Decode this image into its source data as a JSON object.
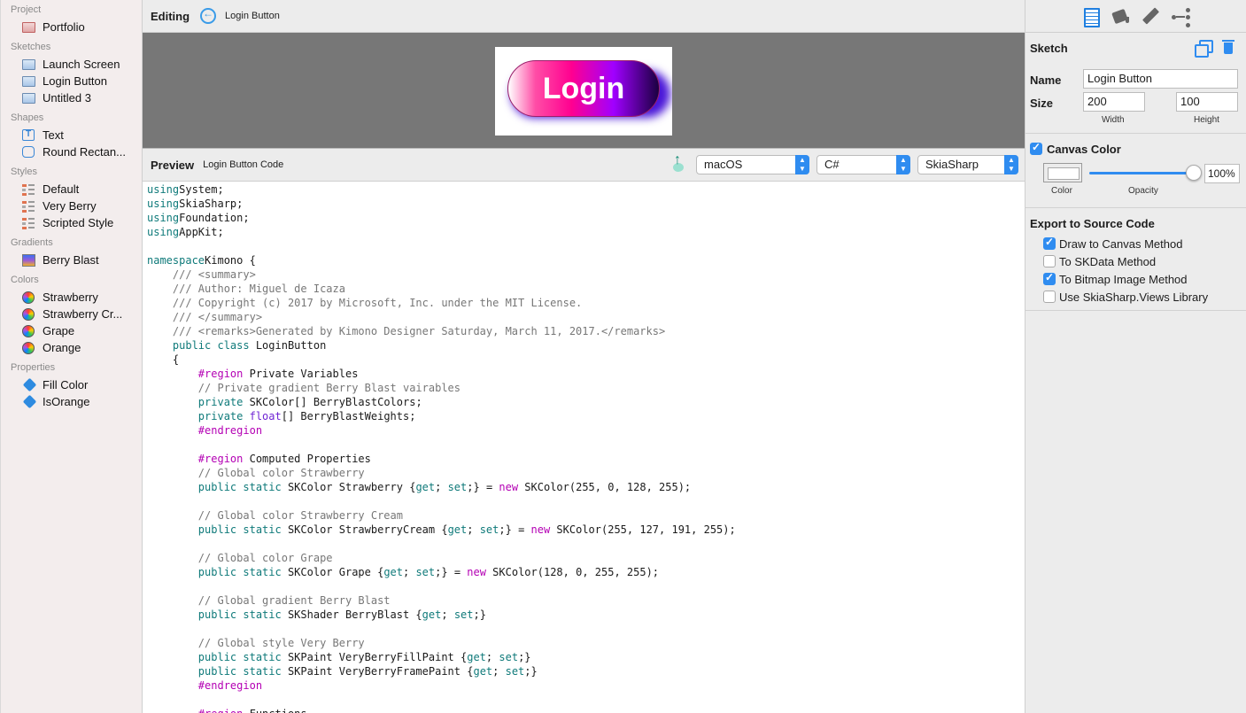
{
  "sidebar": {
    "sections": [
      {
        "title": "Project",
        "items": [
          {
            "label": "Portfolio",
            "icon": "sketch-icon"
          }
        ]
      },
      {
        "title": "Sketches",
        "items": [
          {
            "label": "Launch Screen"
          },
          {
            "label": "Login Button"
          },
          {
            "label": "Untitled 3"
          }
        ]
      },
      {
        "title": "Shapes",
        "items": [
          {
            "label": "Text"
          },
          {
            "label": "Round Rectan..."
          }
        ]
      },
      {
        "title": "Styles",
        "items": [
          {
            "label": "Default"
          },
          {
            "label": "Very Berry"
          },
          {
            "label": "Scripted Style"
          }
        ]
      },
      {
        "title": "Gradients",
        "items": [
          {
            "label": "Berry Blast"
          }
        ]
      },
      {
        "title": "Colors",
        "items": [
          {
            "label": "Strawberry"
          },
          {
            "label": "Strawberry Cr..."
          },
          {
            "label": "Grape"
          },
          {
            "label": "Orange"
          }
        ]
      },
      {
        "title": "Properties",
        "items": [
          {
            "label": "Fill Color"
          },
          {
            "label": "IsOrange"
          }
        ]
      }
    ]
  },
  "editing": {
    "title": "Editing",
    "subtitle": "Login Button",
    "canvas_button_text": "Login"
  },
  "preview": {
    "title": "Preview",
    "subtitle": "Login Button Code",
    "platform": "macOS",
    "language": "C#",
    "library": "SkiaSharp"
  },
  "inspector": {
    "header": "Sketch",
    "name_label": "Name",
    "name_value": "Login Button",
    "size_label": "Size",
    "width_value": "200",
    "height_value": "100",
    "width_caption": "Width",
    "height_caption": "Height",
    "canvas_color_label": "Canvas Color",
    "canvas_color_checked": true,
    "color_caption": "Color",
    "opacity_caption": "Opacity",
    "opacity_value": "100%",
    "opacity_level": 1.0,
    "export_header": "Export to Source Code",
    "export_options": [
      {
        "label": "Draw to Canvas Method",
        "checked": true
      },
      {
        "label": "To SKData Method",
        "checked": false
      },
      {
        "label": "To Bitmap Image Method",
        "checked": true
      },
      {
        "label": "Use SkiaSharp.Views Library",
        "checked": false
      }
    ]
  },
  "colors": {
    "accent": "#2f8cf0",
    "keyword": "#0f7a7a",
    "preprocessor": "#b400b4",
    "comment": "#777777"
  },
  "code": [
    [
      [
        "kw",
        "using"
      ],
      [
        "",
        "System;"
      ]
    ],
    [
      [
        "kw",
        "using"
      ],
      [
        "",
        "SkiaSharp;"
      ]
    ],
    [
      [
        "kw",
        "using"
      ],
      [
        "",
        "Foundation;"
      ]
    ],
    [
      [
        "kw",
        "using"
      ],
      [
        "",
        "AppKit;"
      ]
    ],
    [],
    [
      [
        "kw",
        "namespace"
      ],
      [
        "",
        "Kimono {"
      ]
    ],
    [
      [
        "cm",
        "    /// <summary>"
      ]
    ],
    [
      [
        "cm",
        "    /// Author: Miguel de Icaza"
      ]
    ],
    [
      [
        "cm",
        "    /// Copyright (c) 2017 by Microsoft, Inc. under the MIT License."
      ]
    ],
    [
      [
        "cm",
        "    /// </summary>"
      ]
    ],
    [
      [
        "cm",
        "    /// <remarks>Generated by Kimono Designer Saturday, March 11, 2017.</remarks>"
      ]
    ],
    [
      [
        "kw",
        "    public class"
      ],
      [
        "",
        " LoginButton"
      ]
    ],
    [
      [
        "",
        "    {"
      ]
    ],
    [
      [
        "pp",
        "        #region"
      ],
      [
        "",
        " Private Variables"
      ]
    ],
    [
      [
        "cm",
        "        // Private gradient Berry Blast vairables"
      ]
    ],
    [
      [
        "kw",
        "        private"
      ],
      [
        "",
        " SKColor[] BerryBlastColors;"
      ]
    ],
    [
      [
        "kw",
        "        private"
      ],
      [
        "",
        " "
      ],
      [
        "kw3",
        "float"
      ],
      [
        "",
        "[] BerryBlastWeights;"
      ]
    ],
    [
      [
        "pp",
        "        #endregion"
      ]
    ],
    [],
    [
      [
        "pp",
        "        #region"
      ],
      [
        "",
        " Computed Properties"
      ]
    ],
    [
      [
        "cm",
        "        // Global color Strawberry"
      ]
    ],
    [
      [
        "kw",
        "        public static"
      ],
      [
        "",
        " SKColor Strawberry {"
      ],
      [
        "kw",
        "get"
      ],
      [
        "",
        "; "
      ],
      [
        "kw",
        "set"
      ],
      [
        "",
        ";} = "
      ],
      [
        "kw2",
        "new"
      ],
      [
        "",
        " SKColor(255, 0, 128, 255);"
      ]
    ],
    [],
    [
      [
        "cm",
        "        // Global color Strawberry Cream"
      ]
    ],
    [
      [
        "kw",
        "        public static"
      ],
      [
        "",
        " SKColor StrawberryCream {"
      ],
      [
        "kw",
        "get"
      ],
      [
        "",
        "; "
      ],
      [
        "kw",
        "set"
      ],
      [
        "",
        ";} = "
      ],
      [
        "kw2",
        "new"
      ],
      [
        "",
        " SKColor(255, 127, 191, 255);"
      ]
    ],
    [],
    [
      [
        "cm",
        "        // Global color Grape"
      ]
    ],
    [
      [
        "kw",
        "        public static"
      ],
      [
        "",
        " SKColor Grape {"
      ],
      [
        "kw",
        "get"
      ],
      [
        "",
        "; "
      ],
      [
        "kw",
        "set"
      ],
      [
        "",
        ";} = "
      ],
      [
        "kw2",
        "new"
      ],
      [
        "",
        " SKColor(128, 0, 255, 255);"
      ]
    ],
    [],
    [
      [
        "cm",
        "        // Global gradient Berry Blast"
      ]
    ],
    [
      [
        "kw",
        "        public static"
      ],
      [
        "",
        " SKShader BerryBlast {"
      ],
      [
        "kw",
        "get"
      ],
      [
        "",
        "; "
      ],
      [
        "kw",
        "set"
      ],
      [
        "",
        ";}"
      ]
    ],
    [],
    [
      [
        "cm",
        "        // Global style Very Berry"
      ]
    ],
    [
      [
        "kw",
        "        public static"
      ],
      [
        "",
        " SKPaint VeryBerryFillPaint {"
      ],
      [
        "kw",
        "get"
      ],
      [
        "",
        "; "
      ],
      [
        "kw",
        "set"
      ],
      [
        "",
        ";}"
      ]
    ],
    [
      [
        "kw",
        "        public static"
      ],
      [
        "",
        " SKPaint VeryBerryFramePaint {"
      ],
      [
        "kw",
        "get"
      ],
      [
        "",
        "; "
      ],
      [
        "kw",
        "set"
      ],
      [
        "",
        ";}"
      ]
    ],
    [
      [
        "pp",
        "        #endregion"
      ]
    ],
    [],
    [
      [
        "pp",
        "        #region"
      ],
      [
        "",
        " Functions"
      ]
    ]
  ]
}
